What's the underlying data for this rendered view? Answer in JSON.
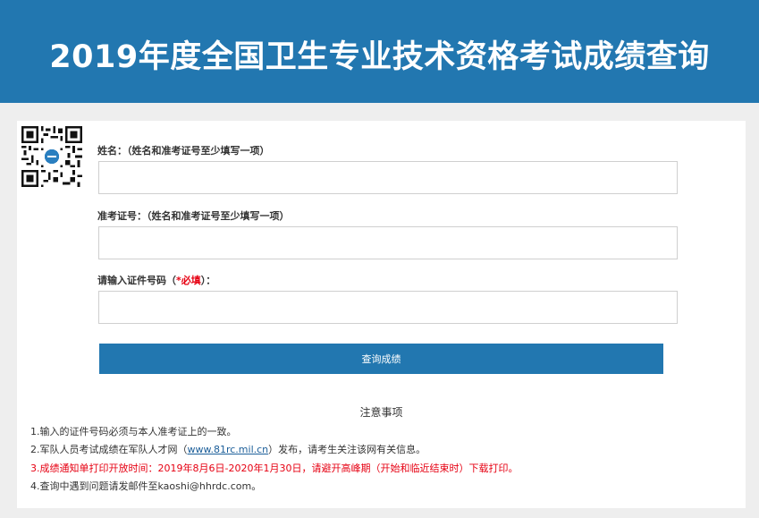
{
  "header": {
    "title": "2019年度全国卫生专业技术资格考试成绩查询"
  },
  "form": {
    "name_label": "姓名：（姓名和准考证号至少填写一项）",
    "ticket_label": "准考证号：（姓名和准考证号至少填写一项）",
    "id_label_prefix": "请输入证件号码（",
    "id_label_required": "*必填",
    "id_label_suffix": "）：",
    "submit_label": "查询成绩"
  },
  "notice": {
    "title": "注意事项",
    "item1": "1.输入的证件号码必须与本人准考证上的一致。",
    "item2_prefix": "2.军队人员考试成绩在军队人才网（",
    "item2_link": "www.81rc.mil.cn",
    "item2_suffix": "）发布，请考生关注该网有关信息。",
    "item3": "3.成绩通知单打印开放时间：2019年8月6日-2020年1月30日，请避开高峰期（开始和临近结束时）下载打印。",
    "item4": "4.查询中遇到问题请发邮件至kaoshi@hhrdc.com。"
  },
  "colors": {
    "accent": "#2277b0",
    "required": "#e60012",
    "page_bg": "#eeeeee"
  },
  "icons": {
    "qr": "qr-code-icon"
  }
}
